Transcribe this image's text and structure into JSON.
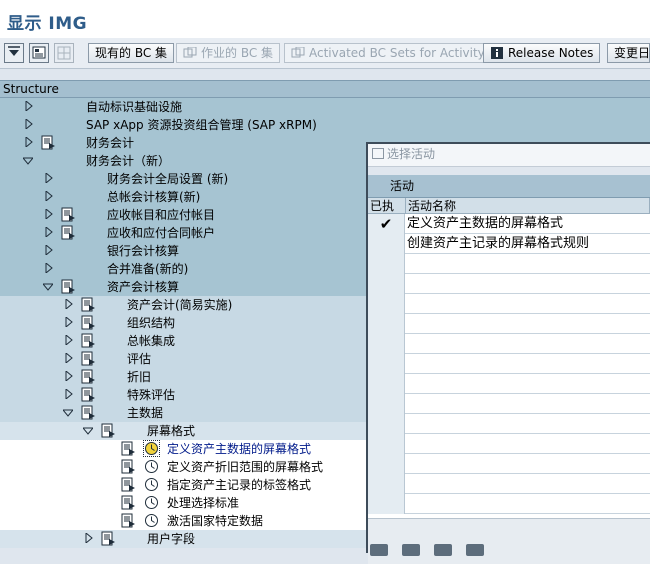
{
  "window": {
    "title": "显示 IMG"
  },
  "toolbar": {
    "existing_bc_sets": "现有的 BC 集",
    "activity_bc_sets": "作业的 BC 集",
    "activated_bc_sets": "Activated BC Sets for Activity",
    "release_notes": "Release Notes",
    "change_log": "变更日"
  },
  "structure": {
    "header": "Structure"
  },
  "tree": {
    "n1": "自动标识基础设施",
    "n2": "SAP xApp 资源投资组合管理 (SAP xRPM)",
    "n3": "财务会计",
    "n4": "财务会计（新）",
    "n5": "财务会计全局设置 (新)",
    "n6": "总帐会计核算(新)",
    "n7": "应收帐目和应付帐目",
    "n8": "应收和应付合同帐户",
    "n9": "银行会计核算",
    "n10": "合并准备(新的)",
    "n11": "资产会计核算",
    "n12": "资产会计(简易实施)",
    "n13": "组织结构",
    "n14": "总帐集成",
    "n15": "评估",
    "n16": "折旧",
    "n17": "特殊评估",
    "n18": "主数据",
    "n19": "屏幕格式",
    "n20": "定义资产主数据的屏幕格式",
    "n21": "定义资产折旧范围的屏幕格式",
    "n22": "指定资产主记录的标签格式",
    "n23": "处理选择标准",
    "n24": "激活国家特定数据",
    "n25": "用户字段"
  },
  "dialog": {
    "title": "选择活动",
    "tab": "活动",
    "col_done": "已执",
    "col_name": "活动名称",
    "rows": [
      {
        "done": "✔",
        "name": "定义资产主数据的屏幕格式"
      },
      {
        "done": "",
        "name": "创建资产主记录的屏幕格式规则"
      }
    ]
  },
  "icons": {
    "expand": "triangle-right",
    "collapse": "triangle-down",
    "doc": "document-icon",
    "clock": "clock-activity-icon",
    "check": "checkmark"
  }
}
